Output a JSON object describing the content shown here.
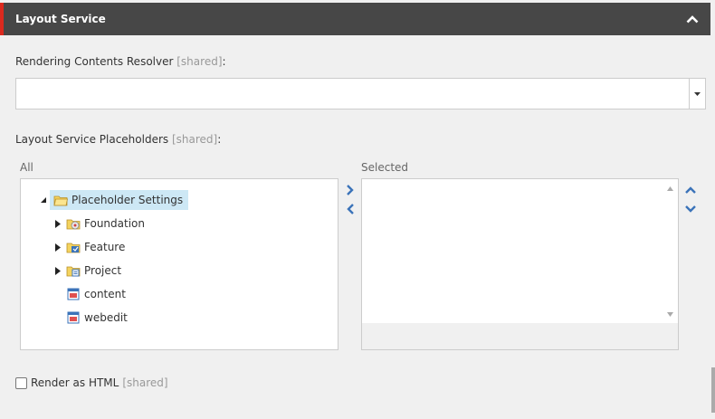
{
  "section": {
    "title": "Layout Service"
  },
  "resolver": {
    "label": "Rendering Contents Resolver",
    "shared_tag": "[shared]",
    "colon": ":",
    "value": ""
  },
  "placeholders": {
    "label": "Layout Service Placeholders",
    "shared_tag": "[shared]",
    "colon": ":",
    "all_label": "All",
    "selected_label": "Selected",
    "tree": {
      "root": "Placeholder Settings",
      "children": [
        {
          "label": "Foundation",
          "icon": "foundation-folder-icon"
        },
        {
          "label": "Feature",
          "icon": "feature-folder-icon"
        },
        {
          "label": "Project",
          "icon": "project-folder-icon"
        },
        {
          "label": "content",
          "icon": "placeholder-icon"
        },
        {
          "label": "webedit",
          "icon": "placeholder-icon"
        }
      ]
    },
    "selected_items": []
  },
  "render_html": {
    "label": "Render as HTML",
    "shared_tag": "[shared]",
    "checked": false
  },
  "colors": {
    "header_bg": "#474747",
    "accent": "#dc291e",
    "arrow_blue": "#3b73b9",
    "highlight": "#cde8f5"
  }
}
